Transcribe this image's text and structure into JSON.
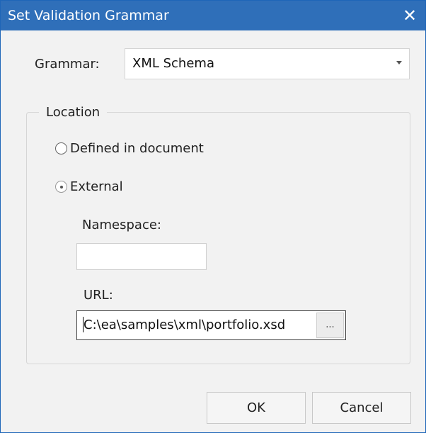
{
  "window": {
    "title": "Set Validation Grammar",
    "close_glyph": "✕"
  },
  "grammar": {
    "label": "Grammar:",
    "selected": "XML Schema"
  },
  "location": {
    "legend": "Location",
    "options": [
      {
        "label": "Defined in document",
        "checked": false
      },
      {
        "label": "External",
        "checked": true
      }
    ],
    "namespace": {
      "label": "Namespace:",
      "value": ""
    },
    "url": {
      "label": "URL:",
      "value": "C:\\ea\\samples\\xml\\portfolio.xsd",
      "browse_label": "..."
    }
  },
  "buttons": {
    "ok": "OK",
    "cancel": "Cancel"
  },
  "colors": {
    "titlebar": "#2f6fb9",
    "background": "#f2f2f2"
  }
}
